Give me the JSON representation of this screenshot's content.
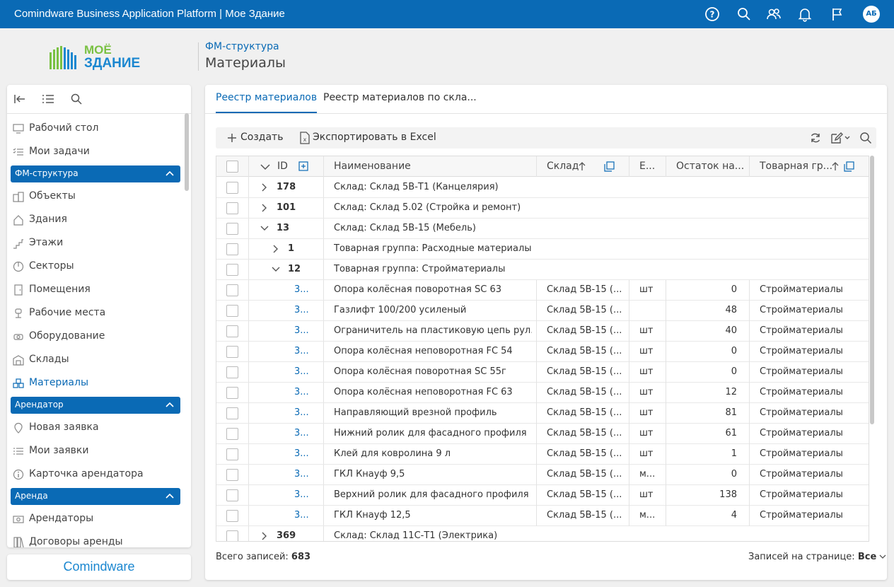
{
  "app": {
    "title": "Comindware Business Application Platform  |  Мое Здание",
    "avatar": "АБ"
  },
  "header": {
    "breadcrumb": "ФМ-структура",
    "title": "Материалы"
  },
  "sidebar": {
    "items_top": [
      {
        "label": "Рабочий стол",
        "icon": "monitor-icon"
      },
      {
        "label": "Мои задачи",
        "icon": "task-list-icon"
      }
    ],
    "groups": [
      {
        "label": "ФМ-структура",
        "items": [
          {
            "label": "Объекты",
            "icon": "buildings-icon"
          },
          {
            "label": "Здания",
            "icon": "house-icon"
          },
          {
            "label": "Этажи",
            "icon": "stairs-icon"
          },
          {
            "label": "Секторы",
            "icon": "pie-icon"
          },
          {
            "label": "Помещения",
            "icon": "door-icon"
          },
          {
            "label": "Рабочие места",
            "icon": "chair-icon"
          },
          {
            "label": "Оборудование",
            "icon": "equipment-icon"
          },
          {
            "label": "Склады",
            "icon": "warehouse-icon"
          },
          {
            "label": "Материалы",
            "icon": "boxes-icon"
          }
        ]
      },
      {
        "label": "Арендатор",
        "items": [
          {
            "label": "Новая заявка",
            "icon": "pin-icon"
          },
          {
            "label": "Мои заявки",
            "icon": "list-icon"
          },
          {
            "label": "Карточка арендатора",
            "icon": "info-icon"
          }
        ]
      },
      {
        "label": "Аренда",
        "items": [
          {
            "label": "Арендаторы",
            "icon": "money-icon"
          },
          {
            "label": "Договоры аренды",
            "icon": "documents-icon"
          }
        ]
      }
    ],
    "brand": "Comindware"
  },
  "tabs": [
    {
      "label": "Реестр материалов"
    },
    {
      "label": "Реестр материалов по скла..."
    }
  ],
  "toolbar": {
    "create": "Создать",
    "export": "Экспортировать в Excel"
  },
  "grid": {
    "columns": [
      "ID",
      "Наименование",
      "Склад",
      "Е...",
      "Остаток на...",
      "Товарная гр..."
    ],
    "rows": [
      {
        "id": "178",
        "name": "Склад:  Склад 5В-Т1 (Канцелярия)",
        "level": 0,
        "expanded": false
      },
      {
        "id": "101",
        "name": "Склад:  Склад 5.02 (Стройка и ремонт)",
        "level": 0,
        "expanded": false
      },
      {
        "id": "13",
        "name": "Склад:  Склад 5В-15 (Мебель)",
        "level": 0,
        "expanded": true
      },
      {
        "id": "1",
        "name": "Товарная группа:  Расходные материалы",
        "level": 1,
        "expanded": false
      },
      {
        "id": "12",
        "name": "Товарная группа:  Стройматериалы",
        "level": 1,
        "expanded": true
      },
      {
        "id": "3...",
        "name": "Опора колёсная поворотная SC 63",
        "stock": "Склад 5В-15 (...",
        "unit": "шт",
        "qty": "0",
        "group": "Стройматериалы",
        "level": 2
      },
      {
        "id": "3...",
        "name": "Газлифт 100/200 усиленый",
        "stock": "Склад 5В-15 (...",
        "unit": "",
        "qty": "48",
        "group": "Стройматериалы",
        "level": 2
      },
      {
        "id": "3...",
        "name": "Ограничитель на пластиковую цепь рул...",
        "stock": "Склад 5В-15 (...",
        "unit": "шт",
        "qty": "40",
        "group": "Стройматериалы",
        "level": 2
      },
      {
        "id": "3...",
        "name": "Опора колёсная неповоротная FC 54",
        "stock": "Склад 5В-15 (...",
        "unit": "шт",
        "qty": "0",
        "group": "Стройматериалы",
        "level": 2
      },
      {
        "id": "3...",
        "name": "Опора колёсная поворотная SC 55г",
        "stock": "Склад 5В-15 (...",
        "unit": "шт",
        "qty": "0",
        "group": "Стройматериалы",
        "level": 2
      },
      {
        "id": "3...",
        "name": "Опора колёсная неповоротная FC 63",
        "stock": "Склад 5В-15 (...",
        "unit": "шт",
        "qty": "12",
        "group": "Стройматериалы",
        "level": 2
      },
      {
        "id": "3...",
        "name": "Направляющий врезной профиль",
        "stock": "Склад 5В-15 (...",
        "unit": "шт",
        "qty": "81",
        "group": "Стройматериалы",
        "level": 2
      },
      {
        "id": "3...",
        "name": "Нижний ролик для фасадного профиля",
        "stock": "Склад 5В-15 (...",
        "unit": "шт",
        "qty": "61",
        "group": "Стройматериалы",
        "level": 2
      },
      {
        "id": "3...",
        "name": "Клей для ковролина 9 л",
        "stock": "Склад 5В-15 (...",
        "unit": "шт",
        "qty": "1",
        "group": "Стройматериалы",
        "level": 2
      },
      {
        "id": "3...",
        "name": "ГКЛ Кнауф 9,5",
        "stock": "Склад 5В-15 (...",
        "unit": "м...",
        "qty": "0",
        "group": "Стройматериалы",
        "level": 2
      },
      {
        "id": "3...",
        "name": "Верхний ролик для фасадного профиля",
        "stock": "Склад 5В-15 (...",
        "unit": "шт",
        "qty": "138",
        "group": "Стройматериалы",
        "level": 2
      },
      {
        "id": "3...",
        "name": "ГКЛ Кнауф 12,5",
        "stock": "Склад 5В-15 (...",
        "unit": "м...",
        "qty": "4",
        "group": "Стройматериалы",
        "level": 2
      },
      {
        "id": "369",
        "name": "Склад:  Склад 11С-Т1 (Электрика)",
        "level": 0,
        "expanded": false
      }
    ]
  },
  "footer": {
    "total_label": "Всего записей:",
    "total": "683",
    "per_page_label": "Записей на странице:",
    "per_page": "Все"
  }
}
